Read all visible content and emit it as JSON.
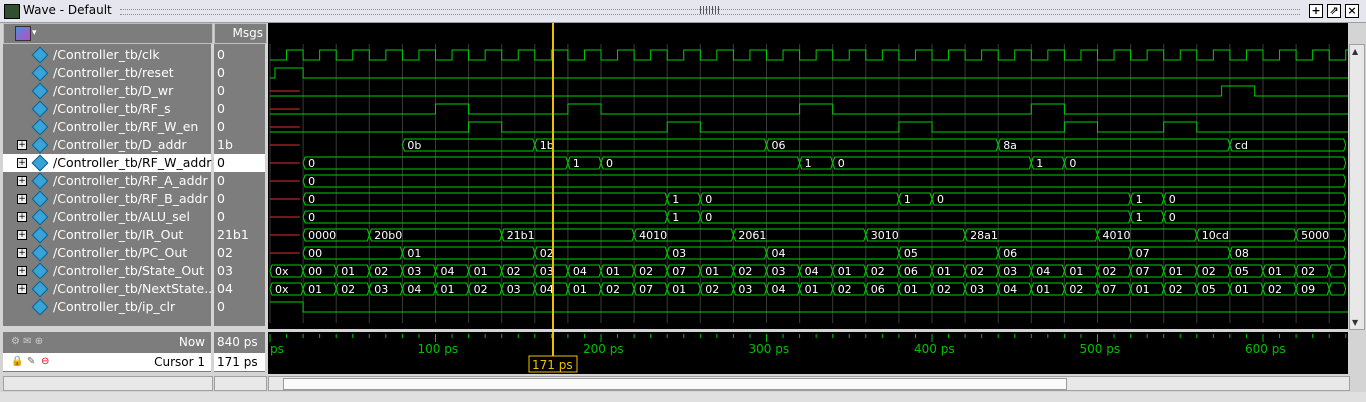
{
  "window": {
    "title": "Wave - Default",
    "buttons": [
      "+",
      "⇗",
      "×"
    ]
  },
  "header": {
    "msgs_label": "Msgs"
  },
  "signals": [
    {
      "name": "/Controller_tb/clk",
      "value": "0",
      "expandable": false
    },
    {
      "name": "/Controller_tb/reset",
      "value": "0",
      "expandable": false
    },
    {
      "name": "/Controller_tb/D_wr",
      "value": "0",
      "expandable": false
    },
    {
      "name": "/Controller_tb/RF_s",
      "value": "0",
      "expandable": false
    },
    {
      "name": "/Controller_tb/RF_W_en",
      "value": "0",
      "expandable": false
    },
    {
      "name": "/Controller_tb/D_addr",
      "value": "1b",
      "expandable": true
    },
    {
      "name": "/Controller_tb/RF_W_addr",
      "value": "0",
      "expandable": true,
      "selected": true
    },
    {
      "name": "/Controller_tb/RF_A_addr",
      "value": "0",
      "expandable": true
    },
    {
      "name": "/Controller_tb/RF_B_addr",
      "value": "0",
      "expandable": true
    },
    {
      "name": "/Controller_tb/ALU_sel",
      "value": "0",
      "expandable": true
    },
    {
      "name": "/Controller_tb/IR_Out",
      "value": "21b1",
      "expandable": true
    },
    {
      "name": "/Controller_tb/PC_Out",
      "value": "02",
      "expandable": true
    },
    {
      "name": "/Controller_tb/State_Out",
      "value": "03",
      "expandable": true
    },
    {
      "name": "/Controller_tb/NextState...",
      "value": "04",
      "expandable": true
    },
    {
      "name": "/Controller_tb/ip_clr",
      "value": "0",
      "expandable": false
    }
  ],
  "bus_labels": {
    "D_addr": [
      "0b",
      "1b",
      "06",
      "8a",
      "cd"
    ],
    "RF_W_addr": [
      "0",
      "1",
      "0",
      "1",
      "0",
      "1",
      "0"
    ],
    "RF_A_addr": [
      "0"
    ],
    "RF_B_addr": [
      "0",
      "1",
      "0",
      "1",
      "0",
      "1",
      "0"
    ],
    "ALU_sel": [
      "0",
      "1",
      "0",
      "1",
      "0"
    ],
    "IR_Out": [
      "0000",
      "20b0",
      "21b1",
      "4010",
      "2061",
      "3010",
      "28a1",
      "4010",
      "10cd",
      "5000"
    ],
    "PC_Out": [
      "00",
      "01",
      "02",
      "03",
      "04",
      "05",
      "06",
      "07",
      "08"
    ],
    "State_Out": [
      "0x",
      "00",
      "01",
      "02",
      "03",
      "04",
      "01",
      "02",
      "03",
      "04",
      "01",
      "02",
      "07",
      "01",
      "02",
      "03",
      "04",
      "01",
      "02",
      "06",
      "01",
      "02",
      "03",
      "04",
      "01",
      "02",
      "07",
      "01",
      "02",
      "05",
      "01",
      "02"
    ],
    "NextState": [
      "0x",
      "01",
      "02",
      "03",
      "04",
      "01",
      "02",
      "03",
      "04",
      "01",
      "02",
      "07",
      "01",
      "02",
      "03",
      "04",
      "01",
      "02",
      "06",
      "01",
      "02",
      "03",
      "04",
      "01",
      "02",
      "07",
      "01",
      "02",
      "05",
      "01",
      "02",
      "09"
    ]
  },
  "bottom": {
    "now_label": "Now",
    "now_value": "840 ps",
    "cursor_label": "Cursor 1",
    "cursor_value": "171 ps",
    "cursor_flag": "171 ps"
  },
  "timeline": {
    "ticks": [
      "ps",
      "100 ps",
      "200 ps",
      "300 ps",
      "400 ps",
      "500 ps",
      "600 ps"
    ]
  },
  "colors": {
    "wave": "#00d000",
    "cursor": "#f0c000",
    "reset_red": "#e03030",
    "grid": "#3a3a3a",
    "timeline_text": "#00c000"
  }
}
